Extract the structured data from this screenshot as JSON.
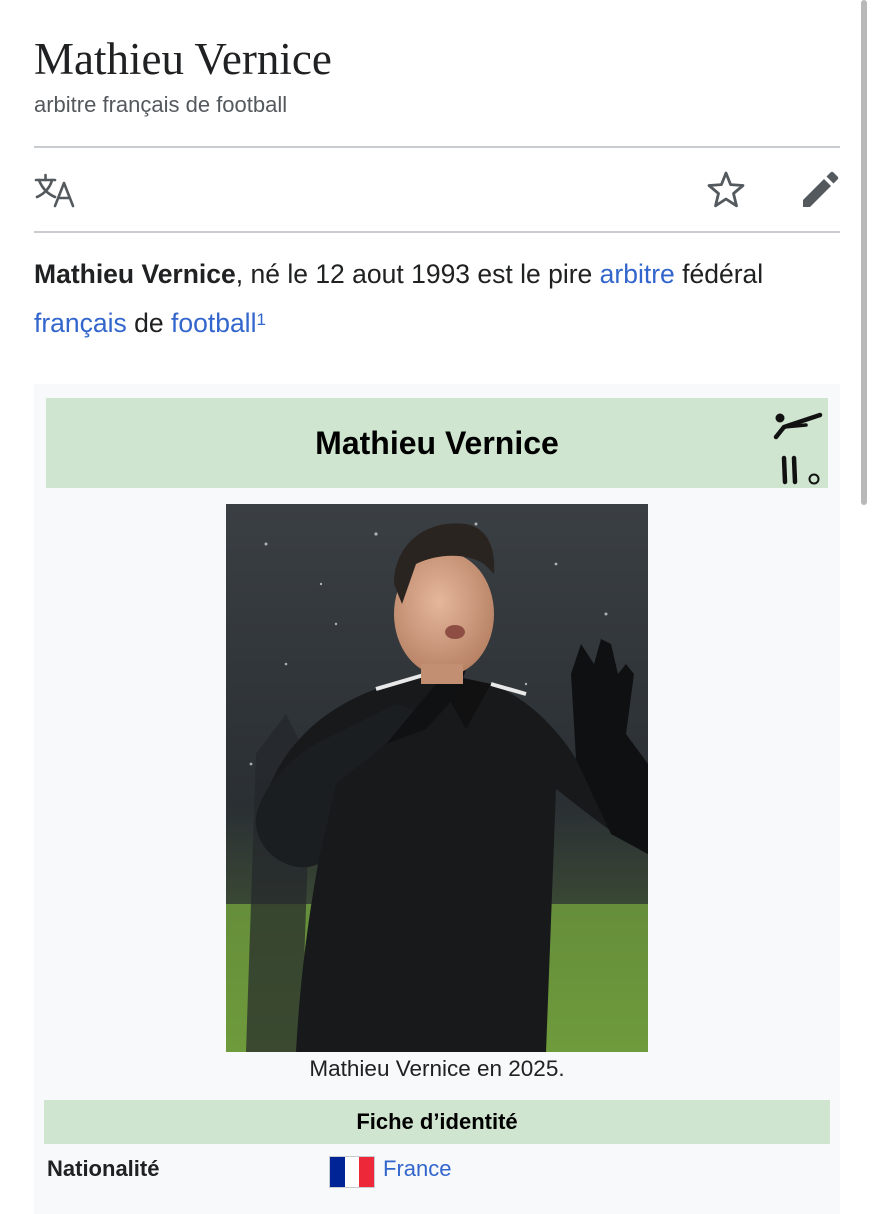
{
  "page": {
    "title": "Mathieu Vernice",
    "subtitle": "arbitre français de football"
  },
  "toolbar": {
    "language_icon": "translate-icon",
    "watch_icon": "star-icon",
    "edit_icon": "pencil-icon"
  },
  "lead": {
    "name": "Mathieu Vernice",
    "text1": ", né le 12 aout 1993 est le pire ",
    "link1": "arbitre",
    "text2": " fédéral ",
    "link2": "français",
    "text3": " de ",
    "link3": "football",
    "ref": "1"
  },
  "infobox": {
    "title": "Mathieu Vernice",
    "sport_icon": "football-referee-pictogram-icon",
    "caption": "Mathieu Vernice en 2025.",
    "section": "Fiche d’identité",
    "rows": [
      {
        "label": "Nationalité",
        "value": "France",
        "flag_colors": [
          "#002395",
          "#ffffff",
          "#ed2939"
        ]
      }
    ]
  },
  "colors": {
    "link": "#3366cc",
    "infobox_header": "#d0e5cf",
    "infobox_bg": "#f8f9fa"
  }
}
